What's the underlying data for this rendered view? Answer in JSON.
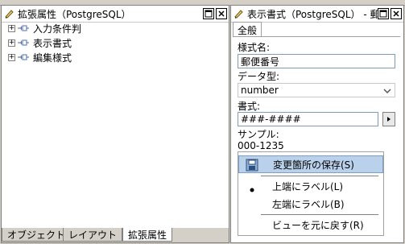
{
  "left_panel": {
    "title": "拡張属性（PostgreSQL）",
    "tree": [
      {
        "label": "入力条件判"
      },
      {
        "label": "表示書式"
      },
      {
        "label": "編集様式"
      }
    ],
    "bottom_tabs": [
      {
        "label": "オブジェクト"
      },
      {
        "label": "レイアウト"
      },
      {
        "label": "拡張属性"
      }
    ]
  },
  "right_panel": {
    "title": "表示書式（PostgreSQL） - 郵",
    "tab_label": "全般",
    "fields": {
      "style_name_label": "様式名:",
      "style_name_value": "郵便番号",
      "data_type_label": "データ型:",
      "data_type_value": "number",
      "format_label": "書式:",
      "format_value": "###-####",
      "sample_label": "サンプル:",
      "sample_value": "000-1235"
    }
  },
  "context_menu": {
    "items": [
      {
        "label": "変更箇所の保存(S)"
      },
      {
        "label": "上端にラベル(L)"
      },
      {
        "label": "左端にラベル(B)"
      },
      {
        "label": "ビューを元に戻す(R)"
      }
    ]
  }
}
